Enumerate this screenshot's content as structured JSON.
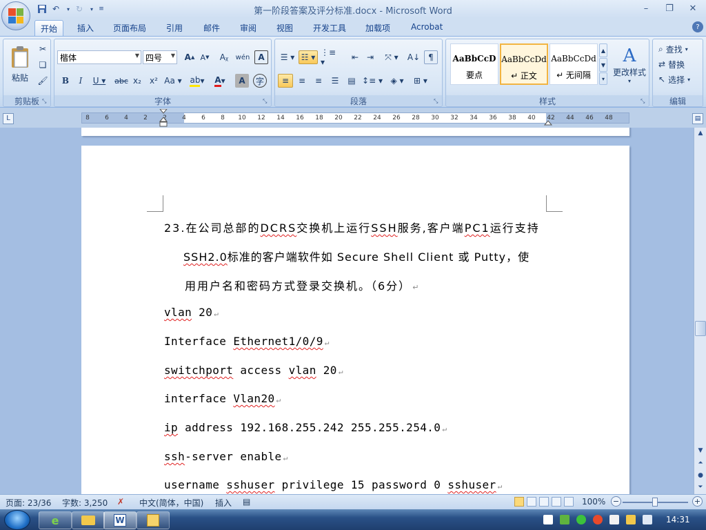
{
  "window": {
    "title": "第一阶段答案及评分标准.docx - Microsoft Word"
  },
  "tabs": [
    "开始",
    "插入",
    "页面布局",
    "引用",
    "邮件",
    "审阅",
    "视图",
    "开发工具",
    "加载项",
    "Acrobat"
  ],
  "ribbon": {
    "clipboard": {
      "label": "剪贴板",
      "paste": "粘贴"
    },
    "font": {
      "label": "字体",
      "font_name": "楷体",
      "font_size": "四号"
    },
    "paragraph": {
      "label": "段落"
    },
    "styles": {
      "label": "样式",
      "items": [
        {
          "sample": "AaBbCcD",
          "name": "要点"
        },
        {
          "sample": "AaBbCcDd",
          "name": "↵ 正文"
        },
        {
          "sample": "AaBbCcDd",
          "name": "↵ 无间隔"
        }
      ],
      "change_styles": "更改样式"
    },
    "editing": {
      "label": "编辑",
      "find": "查找",
      "replace": "替换",
      "select": "选择"
    }
  },
  "ruler": {
    "ticks": [
      "8",
      "6",
      "4",
      "2",
      "2",
      "4",
      "6",
      "8",
      "10",
      "12",
      "14",
      "16",
      "18",
      "20",
      "22",
      "24",
      "26",
      "28",
      "30",
      "32",
      "34",
      "36",
      "38",
      "40",
      "42",
      "44",
      "46",
      "48"
    ]
  },
  "document": {
    "q_num": "23.",
    "q_line1_a": "在公司总部的",
    "q_line1_dcrs": "DCRS",
    "q_line1_b": "交换机上运行",
    "q_line1_ssh": "SSH",
    "q_line1_c": "服务,客户端",
    "q_line1_pc1": "PC1",
    "q_line1_d": "运行支持",
    "q_line2_ssh2": "SSH2.0",
    "q_line2_b": "标准的客户端软件如 Secure Shell Client 或 Putty，使",
    "q_line3": "用用户名和密码方式登录交换机。（6分）",
    "cmd1_a": "vlan",
    "cmd1_b": " 20",
    "cmd2_a": "Interface ",
    "cmd2_b": "Ethernet1/0/9",
    "cmd3_a": "switchport",
    "cmd3_b": " access ",
    "cmd3_c": "vlan",
    "cmd3_d": " 20",
    "cmd4_a": "interface ",
    "cmd4_b": "Vlan20",
    "cmd5_a": "ip",
    "cmd5_b": " address 192.168.255.242 255.255.254.0",
    "cmd6_a": "ssh",
    "cmd6_b": "-server enable",
    "cmd7_a": "username ",
    "cmd7_b": "sshuser",
    "cmd7_c": " privilege 15 password 0 ",
    "cmd7_d": "sshuser",
    "para_mark": "↵"
  },
  "statusbar": {
    "page": "页面: 23/36",
    "words": "字数: 3,250",
    "language": "中文(简体，中国)",
    "mode": "插入",
    "zoom": "100%"
  },
  "taskbar": {
    "clock": "14:31"
  }
}
